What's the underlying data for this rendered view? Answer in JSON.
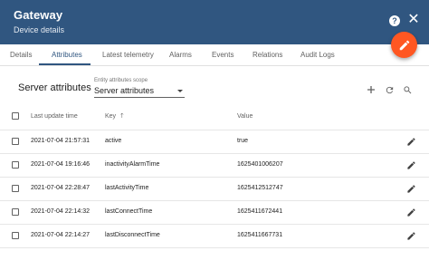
{
  "header": {
    "title": "Gateway",
    "subtitle": "Device details",
    "help_label": "?",
    "close_label": "✕"
  },
  "tabs": [
    {
      "label": "Details",
      "active": false
    },
    {
      "label": "Attributes",
      "active": true
    },
    {
      "label": "Latest telemetry",
      "active": false
    },
    {
      "label": "Alarms",
      "active": false
    },
    {
      "label": "Events",
      "active": false
    },
    {
      "label": "Relations",
      "active": false
    },
    {
      "label": "Audit Logs",
      "active": false
    }
  ],
  "attributes": {
    "title": "Server attributes",
    "scope_label": "Entity attributes scope",
    "scope_value": "Server attributes",
    "toolbar_icons": [
      "add-icon",
      "refresh-icon",
      "search-icon"
    ],
    "columns": {
      "last_update": "Last update time",
      "key": "Key",
      "value": "Value"
    },
    "sort_indicator": "🡑",
    "rows": [
      {
        "time": "2021-07-04 21:57:31",
        "key": "active",
        "value": "true"
      },
      {
        "time": "2021-07-04 19:16:46",
        "key": "inactivityAlarmTime",
        "value": "1625401006207"
      },
      {
        "time": "2021-07-04 22:28:47",
        "key": "lastActivityTime",
        "value": "1625412512747"
      },
      {
        "time": "2021-07-04 22:14:32",
        "key": "lastConnectTime",
        "value": "1625411672441"
      },
      {
        "time": "2021-07-04 22:14:27",
        "key": "lastDisconnectTime",
        "value": "1625411667731"
      }
    ]
  },
  "colors": {
    "header_bg": "#305680",
    "fab": "#ff5722",
    "accent": "#305680"
  }
}
